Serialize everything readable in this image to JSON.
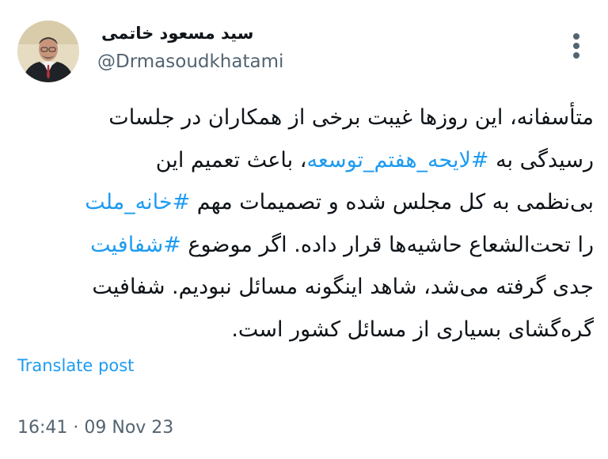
{
  "author": {
    "name": "سید مسعود خاتمی",
    "handle": "@Drmasoudkhatami"
  },
  "tweet": {
    "lines": [
      [
        {
          "text": "متأسفانه، این روزها غیبت برخی از همکاران در جلسات"
        }
      ],
      [
        {
          "text": "رسیدگی به "
        },
        {
          "tag": "#لایحه_هفتم_توسعه"
        },
        {
          "text": "، باعث تعمیم این"
        }
      ],
      [
        {
          "text": "بی‌نظمی به کل مجلس شده و تصمیمات مهم "
        },
        {
          "tag": "#خانه_ملت"
        }
      ],
      [
        {
          "text": "را تحت‌الشعاع حاشیه‌ها قرار داده. اگر موضوع "
        },
        {
          "tag": "#شفافیت"
        }
      ],
      [
        {
          "text": "جدی گرفته می‌شد، شاهد اینگونه مسائل نبودیم. شفافیت"
        }
      ],
      [
        {
          "text": "گره‌گشای بسیاری از مسائل کشور است."
        }
      ]
    ]
  },
  "translate_label": "Translate post",
  "timestamp": "16:41 · 09 Nov 23",
  "colors": {
    "text": "#0f1419",
    "secondary": "#536471",
    "link": "#1d9bf0"
  },
  "icons": {
    "more": "more-vertical-icon",
    "avatar": "avatar-photo"
  }
}
